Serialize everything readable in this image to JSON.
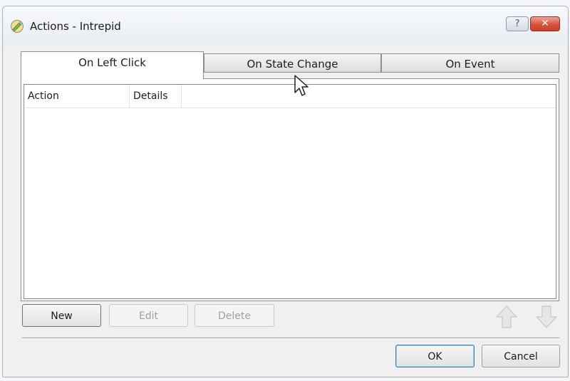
{
  "window": {
    "title": "Actions - Intrepid",
    "help_label": "?",
    "close_label": "✕"
  },
  "tabs": [
    {
      "label": "On Left Click",
      "active": true
    },
    {
      "label": "On State Change",
      "active": false
    },
    {
      "label": "On Event",
      "active": false
    }
  ],
  "list": {
    "columns": [
      "Action",
      "Details"
    ],
    "rows": []
  },
  "actions": {
    "new_label": "New",
    "edit_label": "Edit",
    "delete_label": "Delete",
    "move_up_icon": "arrow-up-icon",
    "move_down_icon": "arrow-down-icon"
  },
  "footer": {
    "ok_label": "OK",
    "cancel_label": "Cancel"
  },
  "colors": {
    "title_bar": "#eef1f6",
    "close_button": "#d7533d",
    "ok_focus": "#3c7fb1"
  }
}
